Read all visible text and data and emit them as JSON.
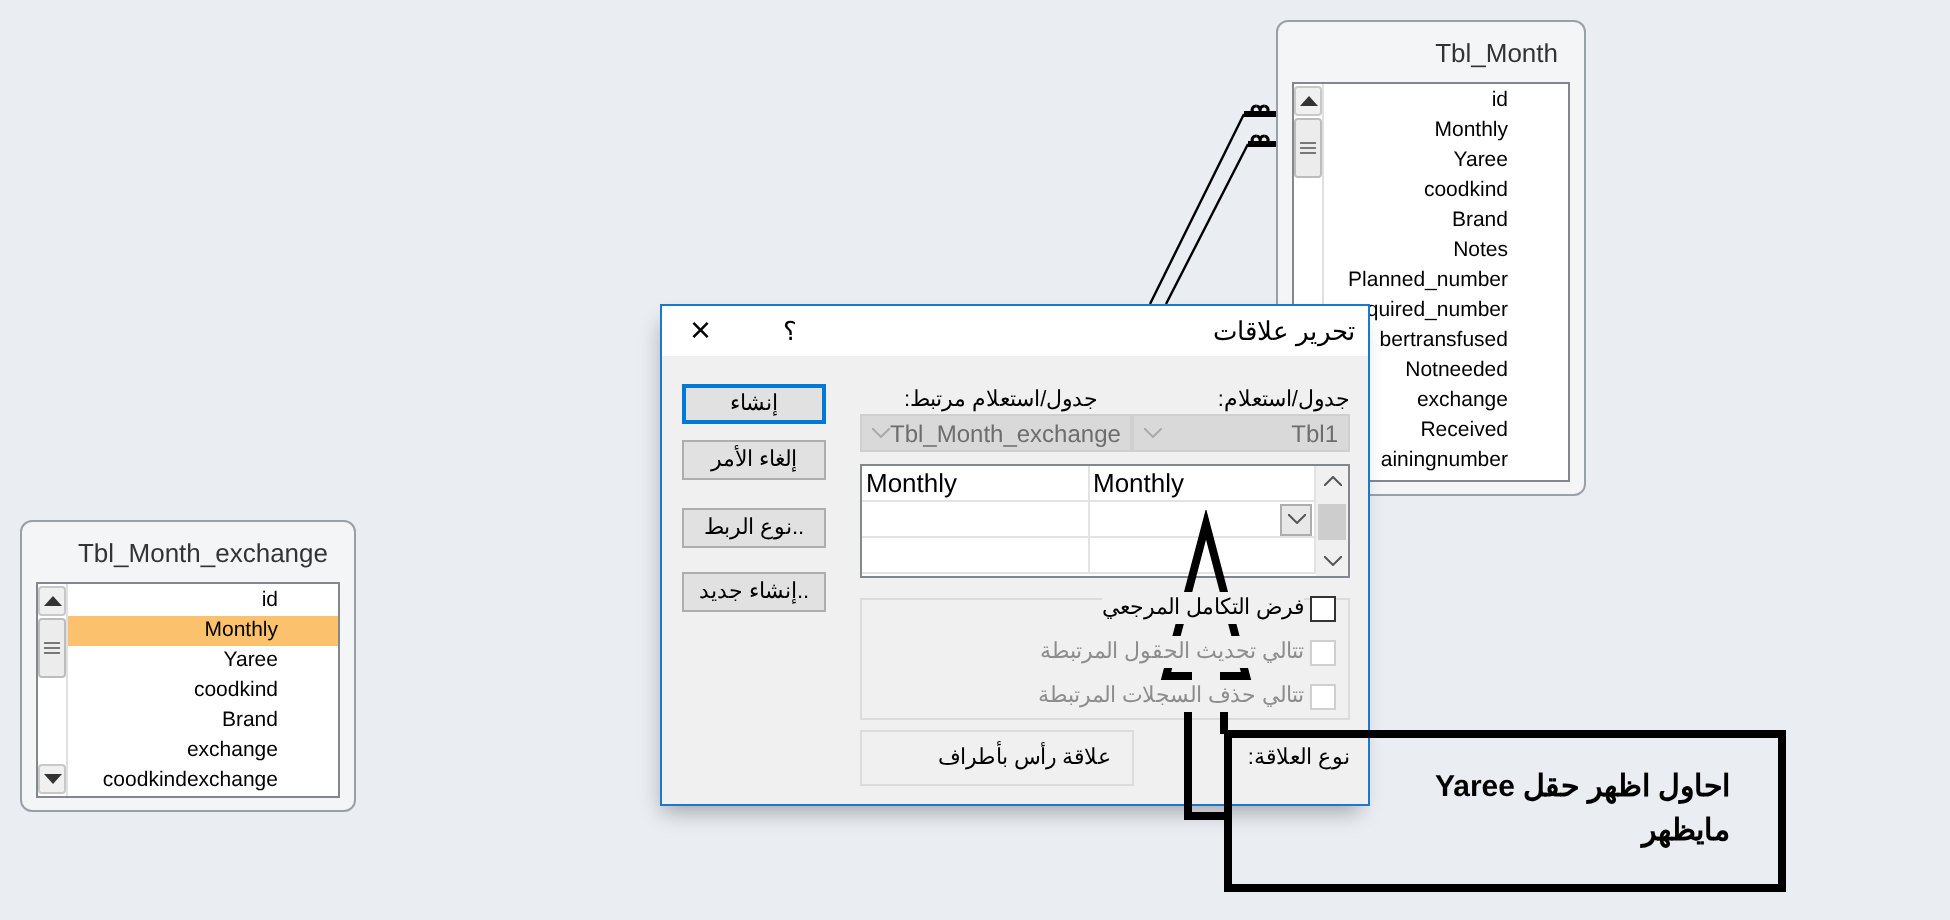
{
  "tables": [
    {
      "title": "Tbl_Month",
      "fields": [
        {
          "label": "id",
          "selected": false
        },
        {
          "label": "Monthly",
          "selected": false
        },
        {
          "label": "Yaree",
          "selected": false
        },
        {
          "label": "coodkind",
          "selected": false
        },
        {
          "label": "Brand",
          "selected": false
        },
        {
          "label": "Notes",
          "selected": false
        },
        {
          "label": "Planned_number",
          "selected": false
        },
        {
          "label": "quired_number",
          "selected": false
        },
        {
          "label": "bertransfused",
          "selected": false
        },
        {
          "label": "Notneeded",
          "selected": false
        },
        {
          "label": "exchange",
          "selected": false
        },
        {
          "label": "Received",
          "selected": false
        },
        {
          "label": "ainingnumber",
          "selected": false
        }
      ]
    },
    {
      "title": "Tbl_Month_exchange",
      "fields": [
        {
          "label": "id",
          "selected": false
        },
        {
          "label": "Monthly",
          "selected": true
        },
        {
          "label": "Yaree",
          "selected": false
        },
        {
          "label": "coodkind",
          "selected": false
        },
        {
          "label": "Brand",
          "selected": false
        },
        {
          "label": "exchange",
          "selected": false
        },
        {
          "label": "coodkindexchange",
          "selected": false
        }
      ]
    }
  ],
  "dialog": {
    "title": "تحرير علاقات",
    "help": "؟",
    "close": "×",
    "table_label": "جدول/استعلام:",
    "related_label": "جدول/استعلام مرتبط:",
    "table_value": "Tbl1",
    "related_value": "Tbl_Month_exchange",
    "grid_rows": [
      {
        "field": "Monthly",
        "related_field": "Monthly"
      }
    ],
    "buttons": [
      {
        "label": "إنشاء",
        "default": true
      },
      {
        "label": "إلغاء الأمر",
        "default": false
      },
      {
        "label": "نوع الربط..",
        "default": false
      },
      {
        "label": "إنشاء جديد..",
        "default": false
      }
    ],
    "options": [
      {
        "label": "فرض التكامل المرجعي",
        "checked": false,
        "disabled": false
      },
      {
        "label": "تتالي تحديث الحقول المرتبطة",
        "checked": false,
        "disabled": true
      },
      {
        "label": "تتالي حذف السجلات المرتبطة",
        "checked": false,
        "disabled": true
      }
    ],
    "relation_type_label": "نوع العلاقة:",
    "relation_type": "علاقة رأس بأطراف"
  },
  "annotation": {
    "text": "احاول اظهر حقل Yaree مايظهر"
  }
}
